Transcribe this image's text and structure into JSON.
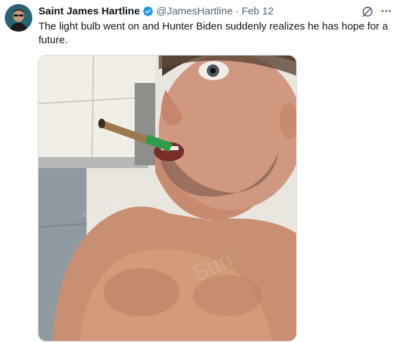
{
  "tweet": {
    "author": {
      "display_name": "Saint James Hartline",
      "handle": "@JamesHartline",
      "verified": true,
      "verified_color": "#1d9bf0"
    },
    "separator": "·",
    "date": "Feb 12",
    "text": "The light bulb went on and Hunter Biden suddenly realizes he has hope for a future.",
    "icons": {
      "avatar": "avatar-photo",
      "verified": "verified-badge-icon",
      "grok": "grok-icon",
      "more": "more-options-icon"
    },
    "media": {
      "type": "photo",
      "description_icon": "photo"
    }
  }
}
